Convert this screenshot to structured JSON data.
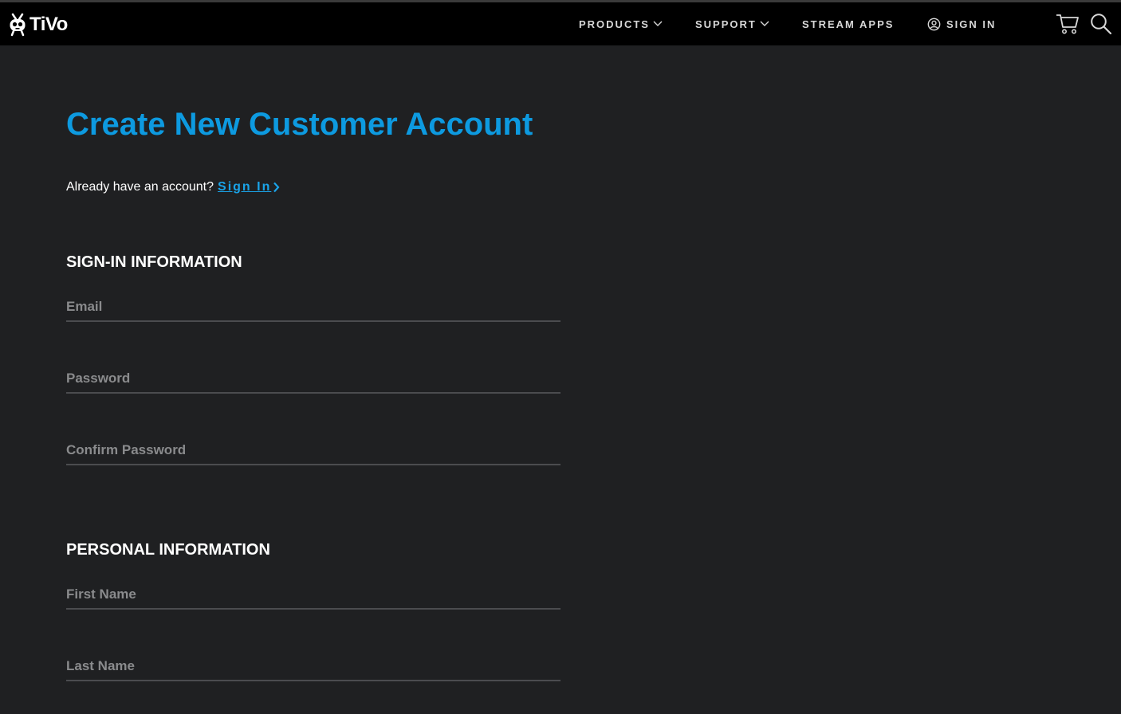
{
  "header": {
    "logo_text": "TiVo",
    "nav": {
      "products": "PRODUCTS",
      "support": "SUPPORT",
      "stream_apps": "STREAM APPS",
      "sign_in": "SIGN IN"
    }
  },
  "main": {
    "title": "Create New Customer Account",
    "already_text": "Already have an account?",
    "signin_link": "Sign In",
    "sections": {
      "signin_info": {
        "heading": "SIGN-IN INFORMATION",
        "email_placeholder": "Email",
        "password_placeholder": "Password",
        "confirm_placeholder": "Confirm Password"
      },
      "personal_info": {
        "heading": "PERSONAL INFORMATION",
        "first_name_placeholder": "First Name",
        "last_name_placeholder": "Last Name"
      }
    }
  },
  "colors": {
    "background": "#1f2022",
    "header": "#000000",
    "accent": "#0d9ae0",
    "field_line": "#4b4c4f",
    "placeholder": "#8a8b8d"
  },
  "icons": [
    "tivo-logo-icon",
    "chevron-down-icon",
    "user-circle-icon",
    "cart-icon",
    "search-icon",
    "chevron-right-icon"
  ]
}
